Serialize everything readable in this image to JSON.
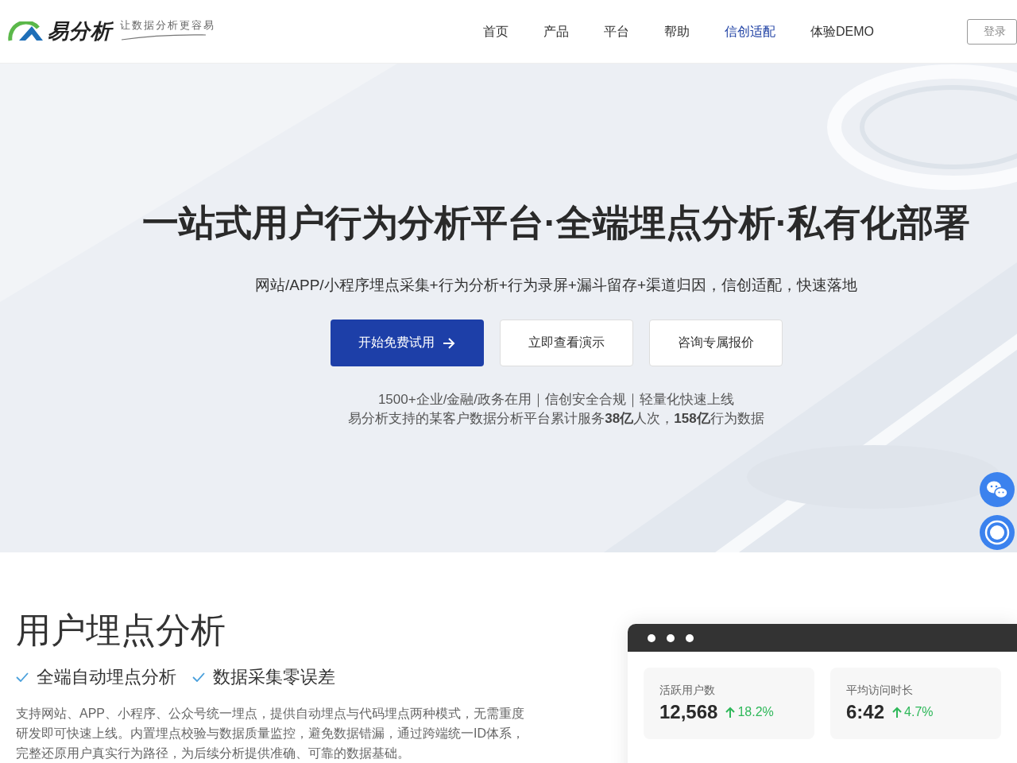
{
  "header": {
    "logo_text": "易分析",
    "slogan": "让数据分析更容易",
    "nav": [
      {
        "label": "首页",
        "selected": false
      },
      {
        "label": "产品",
        "selected": false
      },
      {
        "label": "平台",
        "selected": false
      },
      {
        "label": "帮助",
        "selected": false
      },
      {
        "label": "信创适配",
        "selected": true
      },
      {
        "label": "体验DEMO",
        "selected": false
      }
    ],
    "login_button": "登录"
  },
  "hero": {
    "title": "一站式用户行为分析平台·全端埋点分析·私有化部署",
    "subtitle": "网站/APP/小程序埋点采集+行为分析+行为录屏+漏斗留存+渠道归因，信创适配，快速落地",
    "buttons": [
      {
        "label": "开始免费试用",
        "kind": "primary"
      },
      {
        "label": "立即查看演示",
        "kind": "secondary"
      },
      {
        "label": "咨询专属报价",
        "kind": "secondary"
      }
    ],
    "stats_lines": [
      "1500+企业/金融/政务在用｜信创安全合规｜轻量化快速上线",
      "易分析支持的某客户数据分析平台累计服务**38亿**人次，**158亿**行为数据"
    ]
  },
  "float_buttons": [
    {
      "kind": "wechat"
    },
    {
      "kind": "target"
    }
  ],
  "feature": {
    "title": "用户埋点分析",
    "checks": [
      "全端自动埋点分析",
      "数据采集零误差"
    ],
    "description": "支持网站、APP、小程序、公众号统一埋点，提供自动埋点与代码埋点两种模式，无需重度研发即可快速上线。内置埋点校验与数据质量监控，避免数据错漏，通过跨端统一ID体系，完整还原用户真实行为路径，为后续分析提供准确、可靠的数据基础。"
  },
  "dashboard": {
    "metrics": [
      {
        "label": "活跃用户数",
        "value": "12,568",
        "change": "18.2%"
      },
      {
        "label": "平均访问时长",
        "value": "6:42",
        "change": "4.7%"
      }
    ]
  }
}
